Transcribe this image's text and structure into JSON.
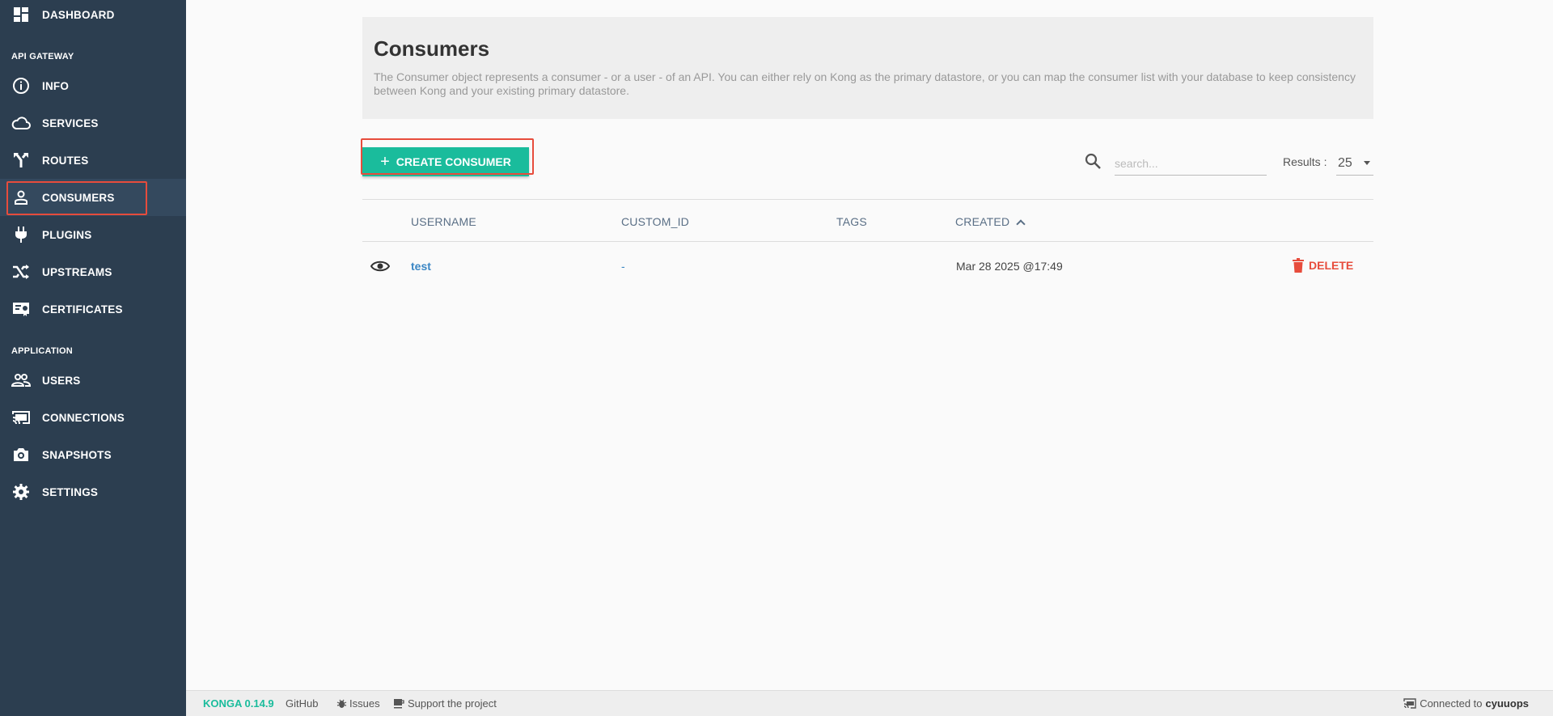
{
  "sidebar": {
    "items": [
      {
        "name": "dashboard",
        "label": "DASHBOARD",
        "icon": "dashboard-icon"
      },
      {
        "name": "info",
        "label": "INFO",
        "icon": "info-icon"
      },
      {
        "name": "services",
        "label": "SERVICES",
        "icon": "cloud-icon"
      },
      {
        "name": "routes",
        "label": "ROUTES",
        "icon": "routes-icon"
      },
      {
        "name": "consumers",
        "label": "CONSUMERS",
        "icon": "person-icon"
      },
      {
        "name": "plugins",
        "label": "PLUGINS",
        "icon": "plug-icon"
      },
      {
        "name": "upstreams",
        "label": "UPSTREAMS",
        "icon": "shuffle-icon"
      },
      {
        "name": "certificates",
        "label": "CERTIFICATES",
        "icon": "certificate-icon"
      },
      {
        "name": "users",
        "label": "USERS",
        "icon": "people-icon"
      },
      {
        "name": "connections",
        "label": "CONNECTIONS",
        "icon": "cast-icon"
      },
      {
        "name": "snapshots",
        "label": "SNAPSHOTS",
        "icon": "camera-icon"
      },
      {
        "name": "settings",
        "label": "SETTINGS",
        "icon": "gear-icon"
      }
    ],
    "sections": {
      "api_gateway": "API GATEWAY",
      "application": "APPLICATION"
    },
    "active": "CONSUMERS"
  },
  "header": {
    "title": "Consumers",
    "description": "The Consumer object represents a consumer - or a user - of an API. You can either rely on Kong as the primary datastore, or you can map the consumer list with your database to keep consistency between Kong and your existing primary datastore."
  },
  "toolbar": {
    "create_label": "CREATE CONSUMER",
    "search_placeholder": "search...",
    "results_label": "Results :",
    "results_value": "25"
  },
  "table": {
    "headers": {
      "username": "USERNAME",
      "custom_id": "CUSTOM_ID",
      "tags": "TAGS",
      "created": "CREATED"
    },
    "rows": [
      {
        "username": "test",
        "custom_id": "-",
        "tags": "",
        "created": "Mar 28 2025 @17:49",
        "delete_label": "DELETE"
      }
    ]
  },
  "footer": {
    "brand": "KONGA 0.14.9",
    "github": "GitHub",
    "issues": "Issues",
    "support": "Support the project",
    "connected_prefix": "Connected to",
    "connected_name": "cyuuops"
  },
  "colors": {
    "sidebar_bg": "#2c3e50",
    "accent": "#1abc9c",
    "danger": "#e74c3c",
    "link": "#3a86c4",
    "highlight": "#e74c3c"
  }
}
